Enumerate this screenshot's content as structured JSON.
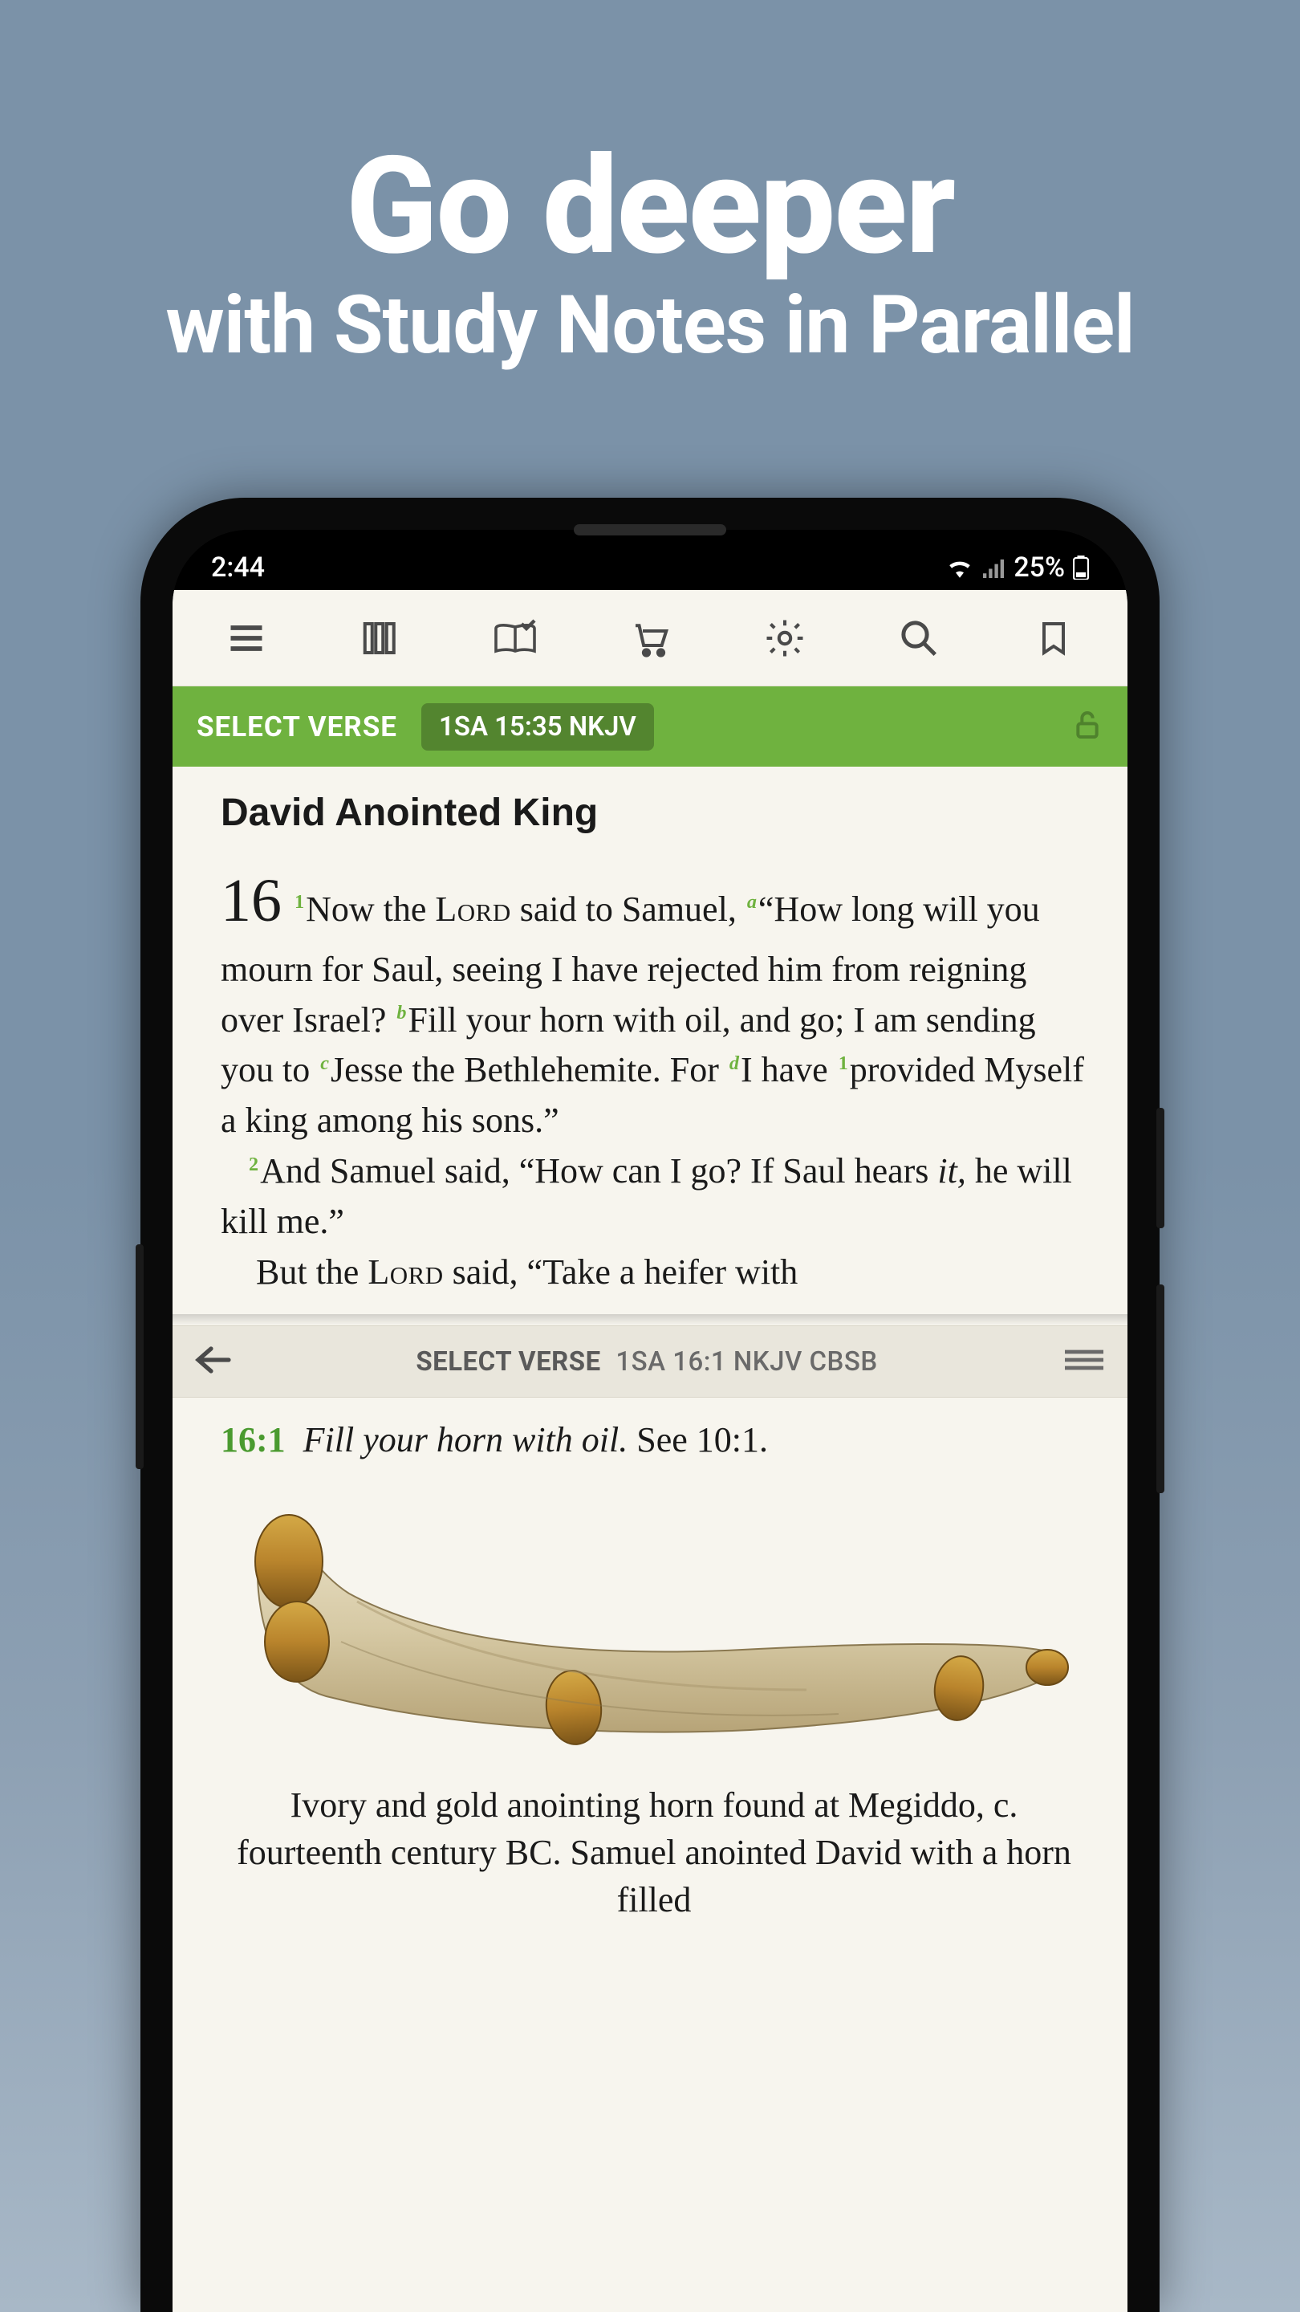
{
  "promo": {
    "big": "Go deeper",
    "sub": "with Study Notes in Parallel"
  },
  "statusbar": {
    "time": "2:44",
    "battery": "25%"
  },
  "greenbar": {
    "select_verse": "SELECT VERSE",
    "reference": "1SA 15:35 NKJV"
  },
  "scripture": {
    "heading": "David Anointed King",
    "chapter": "16",
    "text_parts": {
      "t1": "Now the ",
      "lord1": "Lord",
      "t2": " said to Samuel, ",
      "t3": "“How long will you mourn for Saul, seeing I have rejected him from reigning over Israel? ",
      "t4": "Fill your horn with oil, and go; I am sending you to ",
      "t5": "Jesse the Bethlehemite. For ",
      "t6": "I have ",
      "t7": "provided Myself a king among his sons.”",
      "t8": "And Samuel said, “How can I go? If Saul hears ",
      "it": "it,",
      "t9": " he will kill me.”",
      "t10": "But the ",
      "lord2": "Lord",
      "t11": " said, “Take a heifer with"
    }
  },
  "panel": {
    "select_verse": "SELECT VERSE",
    "reference": "1SA 16:1 NKJV CBSB"
  },
  "study": {
    "vref": "16:1",
    "lead": "Fill your horn with oil.",
    "see": " See 10:1.",
    "caption": "Ivory and gold anointing horn found at Megiddo, c. fourteenth century BC. Samuel anointed David with a horn filled"
  }
}
